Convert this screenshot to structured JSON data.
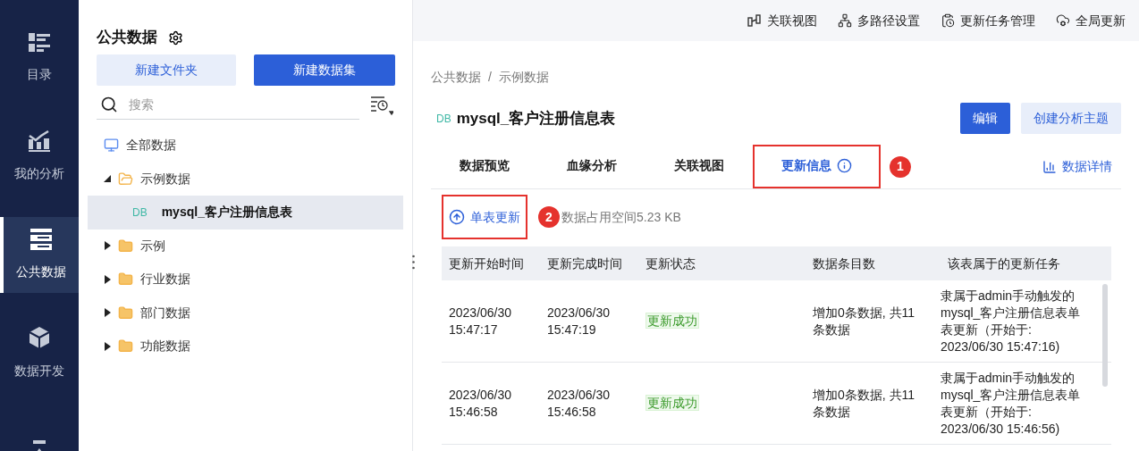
{
  "nav": [
    {
      "kind": "catalog",
      "label": "目录",
      "selected": false
    },
    {
      "kind": "analysis",
      "label": "我的分析",
      "selected": false
    },
    {
      "kind": "public",
      "label": "公共数据",
      "selected": true
    },
    {
      "kind": "dev",
      "label": "数据开发",
      "selected": false
    },
    {
      "kind": "more",
      "selected": false
    }
  ],
  "panel": {
    "title": "公共数据",
    "buttons": [
      {
        "label": "新建文件夹",
        "primary": false
      },
      {
        "label": "新建数据集",
        "primary": true
      }
    ],
    "search": {
      "placeholder": "搜索"
    }
  },
  "tree": [
    {
      "kind": "root",
      "label": "全部数据",
      "children": [
        {
          "kind": "folder",
          "label": "示例数据",
          "expanded": true,
          "children": [
            {
              "kind": "table",
              "tag": "DB",
              "label": "mysql_客户注册信息表",
              "selected": true
            }
          ]
        },
        {
          "kind": "folder",
          "label": "示例",
          "expanded": false
        },
        {
          "kind": "folder",
          "label": "行业数据",
          "expanded": false
        },
        {
          "kind": "folder",
          "label": "部门数据",
          "expanded": false
        },
        {
          "kind": "folder",
          "label": "功能数据",
          "expanded": false
        }
      ]
    }
  ],
  "toolbar": [
    {
      "kind": "relation",
      "label": "关联视图"
    },
    {
      "kind": "multipath",
      "label": "多路径设置"
    },
    {
      "kind": "tasks",
      "label": "更新任务管理"
    },
    {
      "kind": "global",
      "label": "全局更新"
    }
  ],
  "breadcrumb": {
    "separator": "/",
    "items": [
      "公共数据",
      "示例数据"
    ]
  },
  "dataset": {
    "tag": "DB",
    "title": "mysql_客户注册信息表",
    "actions": [
      {
        "label": "编辑",
        "primary": true
      },
      {
        "label": "创建分析主题",
        "primary": false
      }
    ]
  },
  "tabs": [
    {
      "label": "数据预览",
      "selected": false
    },
    {
      "label": "血缘分析",
      "selected": false
    },
    {
      "label": "关联视图",
      "selected": false
    },
    {
      "label": "更新信息",
      "selected": true,
      "info": true
    }
  ],
  "details_link": "数据详情",
  "annotations": [
    "1",
    "2"
  ],
  "update_button": "单表更新",
  "storage": "数据占用空间5.23 KB",
  "table": {
    "columns": [
      "更新开始时间",
      "更新完成时间",
      "更新状态",
      "数据条目数",
      "该表属于的更新任务"
    ],
    "rows": [
      [
        "2023/06/30 15:47:17",
        "2023/06/30 15:47:19",
        "更新成功",
        "增加0条数据, 共11条数据",
        "隶属于admin手动触发的mysql_客户注册信息表单表更新（开始于: 2023/06/30 15:47:16)"
      ],
      [
        "2023/06/30 15:46:58",
        "2023/06/30 15:46:58",
        "更新成功",
        "增加0条数据, 共11条数据",
        "隶属于admin手动触发的mysql_客户注册信息表单表更新（开始于: 2023/06/30 15:46:56)"
      ]
    ]
  }
}
